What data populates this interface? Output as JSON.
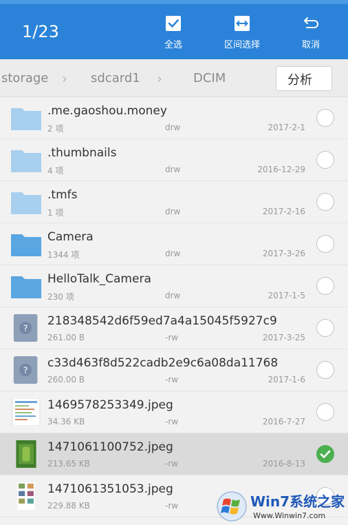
{
  "topbar": {
    "counter": "1/23",
    "actions": [
      {
        "label": "全选",
        "icon": "checkbox-icon"
      },
      {
        "label": "区间选择",
        "icon": "range-select-icon"
      },
      {
        "label": "取消",
        "icon": "back-arrow-icon"
      }
    ],
    "color": "#2a83d8"
  },
  "path": {
    "crumbs": [
      "storage",
      "sdcard1",
      "DCIM"
    ],
    "analyze_label": "分析"
  },
  "files": [
    {
      "name": ".me.gaoshou.money",
      "meta": "2 项",
      "perm": "drw",
      "date": "2017-2-1",
      "type": "folder-light",
      "selected": false
    },
    {
      "name": ".thumbnails",
      "meta": "4 项",
      "perm": "drw",
      "date": "2016-12-29",
      "type": "folder-light",
      "selected": false
    },
    {
      "name": ".tmfs",
      "meta": "1 项",
      "perm": "drw",
      "date": "2017-2-16",
      "type": "folder-light",
      "selected": false
    },
    {
      "name": "Camera",
      "meta": "1344 项",
      "perm": "drw",
      "date": "2017-3-26",
      "type": "folder",
      "selected": false
    },
    {
      "name": "HelloTalk_Camera",
      "meta": "230 项",
      "perm": "drw",
      "date": "2017-1-5",
      "type": "folder",
      "selected": false
    },
    {
      "name": "218348542d6f59ed7a4a15045f5927c9",
      "meta": "261.00 B",
      "perm": "-rw",
      "date": "2017-3-25",
      "type": "unknown",
      "selected": false
    },
    {
      "name": "c33d463f8d522cadb2e9c6a08da11768",
      "meta": "260.00 B",
      "perm": "-rw",
      "date": "2017-1-6",
      "type": "unknown",
      "selected": false
    },
    {
      "name": "1469578253349.jpeg",
      "meta": "34.36 KB",
      "perm": "-rw",
      "date": "2016-7-27",
      "type": "image-doc",
      "selected": false
    },
    {
      "name": "1471061100752.jpeg",
      "meta": "213.65 KB",
      "perm": "-rw",
      "date": "2016-8-13",
      "type": "image-green",
      "selected": true
    },
    {
      "name": "1471061351053.jpeg",
      "meta": "229.88 KB",
      "perm": "-rw",
      "date": "",
      "type": "image-grid",
      "selected": false
    }
  ],
  "watermark": {
    "brand": "Win7系统之家",
    "url": "Www.Winwin7.com"
  },
  "colors": {
    "folder_light": "#a9cfee",
    "folder": "#5aa6e2",
    "unknown_file": "#8e9fb8",
    "check_on": "#4caf50"
  }
}
